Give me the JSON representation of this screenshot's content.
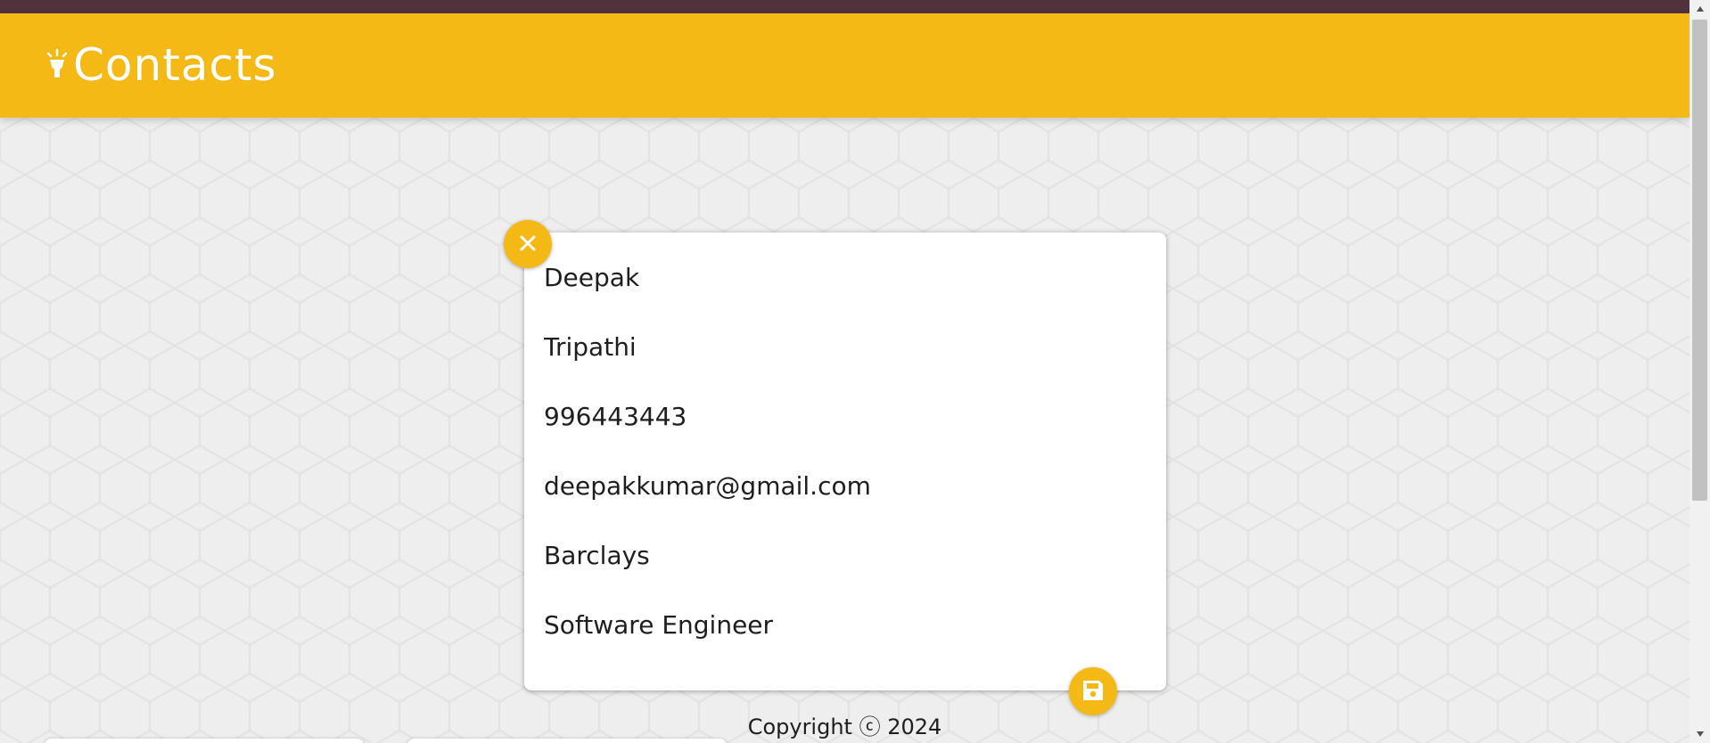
{
  "header": {
    "title": "Contacts",
    "icon": "lightbulb-icon",
    "bg_color": "#f5b916",
    "top_strip_color": "#51323c"
  },
  "note": {
    "fields": [
      {
        "name": "first-name-field",
        "value": "Deepak"
      },
      {
        "name": "last-name-field",
        "value": "Tripathi"
      },
      {
        "name": "phone-field",
        "value": "996443443"
      },
      {
        "name": "email-field",
        "value": "deepakkumar@gmail.com"
      },
      {
        "name": "company-field",
        "value": "Barclays"
      },
      {
        "name": "job-title-field",
        "value": "Software Engineer"
      }
    ],
    "close_icon": "close-icon",
    "save_icon": "save-icon"
  },
  "footer": {
    "text": "Copyright ⓒ 2024"
  },
  "accent_color": "#f5b916"
}
